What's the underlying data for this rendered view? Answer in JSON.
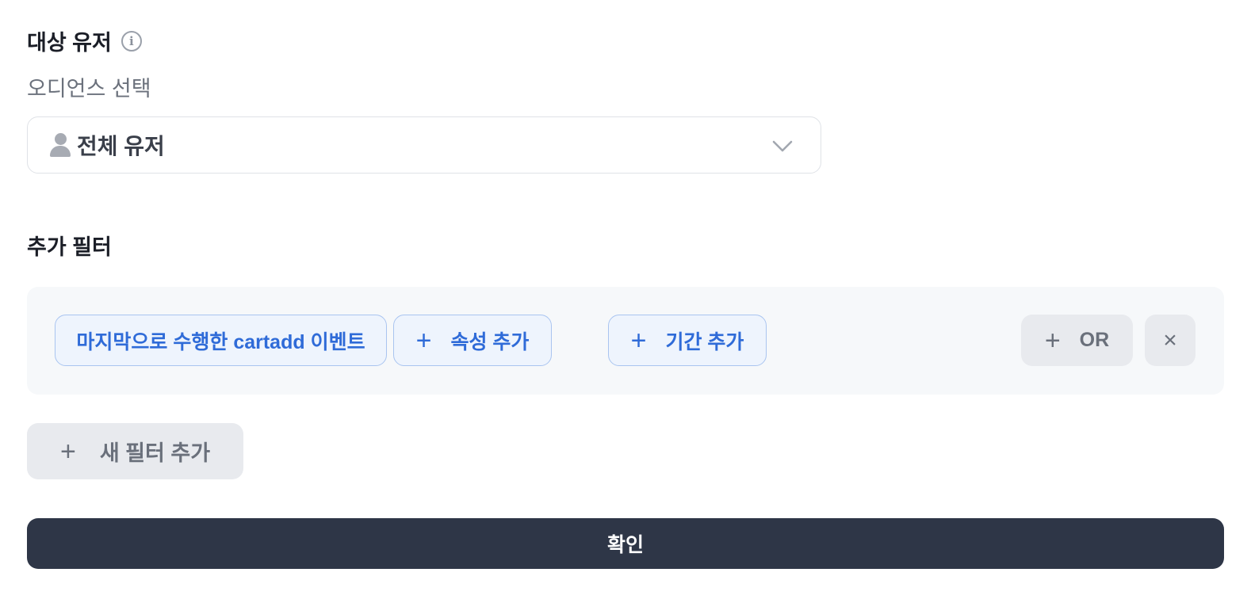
{
  "target_users": {
    "title": "대상 유저",
    "info_icon": "i",
    "subtitle": "오디언스 선택",
    "audience_select": {
      "icon": "user-icon",
      "value": "전체 유저",
      "chevron": "chevron-down-icon"
    }
  },
  "additional_filter": {
    "title": "추가 필터",
    "filter_row": {
      "event_chip": "마지막으로 수행한 cartadd 이벤트",
      "add_attribute": "속성 추가",
      "add_period": "기간 추가",
      "or_button": "OR",
      "remove_icon": "×",
      "plus_symbol": "+"
    },
    "new_filter_button": "새 필터 추가"
  },
  "confirm_button": "확인",
  "colors": {
    "accent_blue": "#2f6bd8",
    "chip_bg": "#eef4fd",
    "chip_border": "#a9c4f0",
    "panel_bg": "#f6f8fa",
    "gray_button_bg": "#e8eaee",
    "confirm_bg": "#2e3647"
  }
}
